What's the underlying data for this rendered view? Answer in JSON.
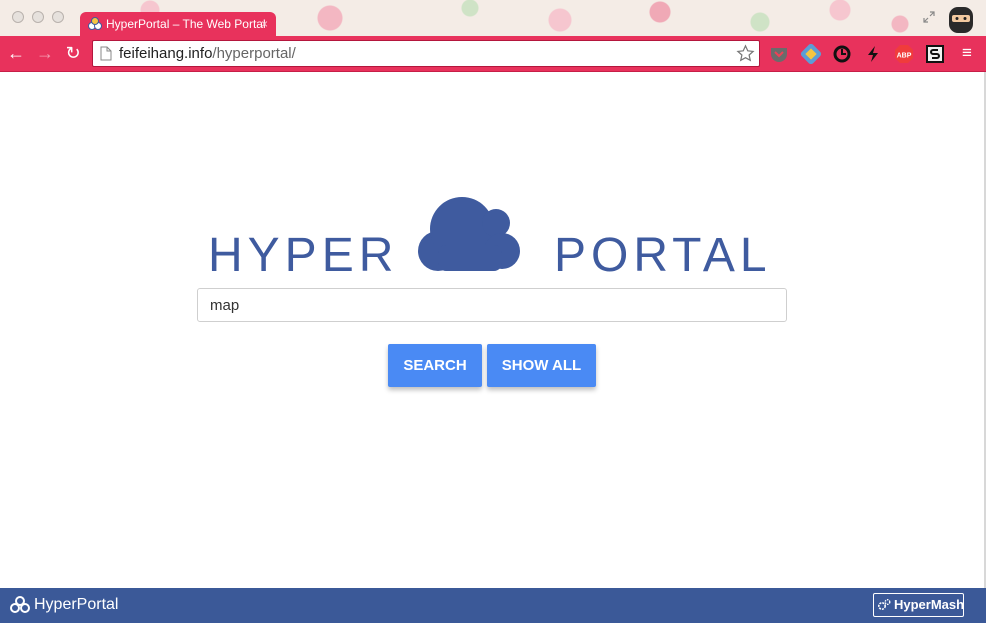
{
  "browser": {
    "tab_title": "HyperPortal – The Web Portal",
    "tab_close": "×",
    "url_host": "feifeihang.info",
    "url_path": "/hyperportal/",
    "extensions": [
      "pocket-icon",
      "feedly-icon",
      "timer-icon",
      "lightning-icon",
      "adblock-plus-icon",
      "stylish-icon"
    ],
    "adblock_label": "ABP",
    "accent_color": "#e8325c"
  },
  "main": {
    "logo_left": "HYPER",
    "logo_right": "PORTAL",
    "search_value": "map",
    "search_button": "SEARCH",
    "show_all_button": "SHOW ALL",
    "brand_color": "#3f5b9f",
    "button_color": "#4a8af4"
  },
  "footer": {
    "title": "HyperPortal",
    "mash_button": "HyperMash",
    "color": "#3b5998"
  }
}
